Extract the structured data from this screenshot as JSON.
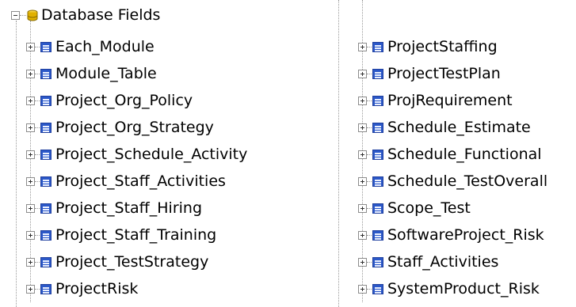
{
  "root": {
    "label": "Database Fields",
    "icon": "database-icon",
    "expanded": true
  },
  "partial_item_label": "",
  "column_left": [
    "Each_Module",
    "Module_Table",
    "Project_Org_Policy",
    "Project_Org_Strategy",
    "Project_Schedule_Activity",
    "Project_Staff_Activities",
    "Project_Staff_Hiring",
    "Project_Staff_Training",
    "Project_TestStrategy",
    "ProjectRisk"
  ],
  "column_right": [
    "ProjectStaffing",
    "ProjectTestPlan",
    "ProjRequirement",
    "Schedule_Estimate",
    "Schedule_Functional",
    "Schedule_TestOverall",
    "Scope_Test",
    "SoftwareProject_Risk",
    "Staff_Activities",
    "SystemProduct_Risk"
  ],
  "colors": {
    "table_icon": "#2b58c8",
    "database_icon": "#e0b000",
    "tree_lines": "#9a9a9a"
  }
}
